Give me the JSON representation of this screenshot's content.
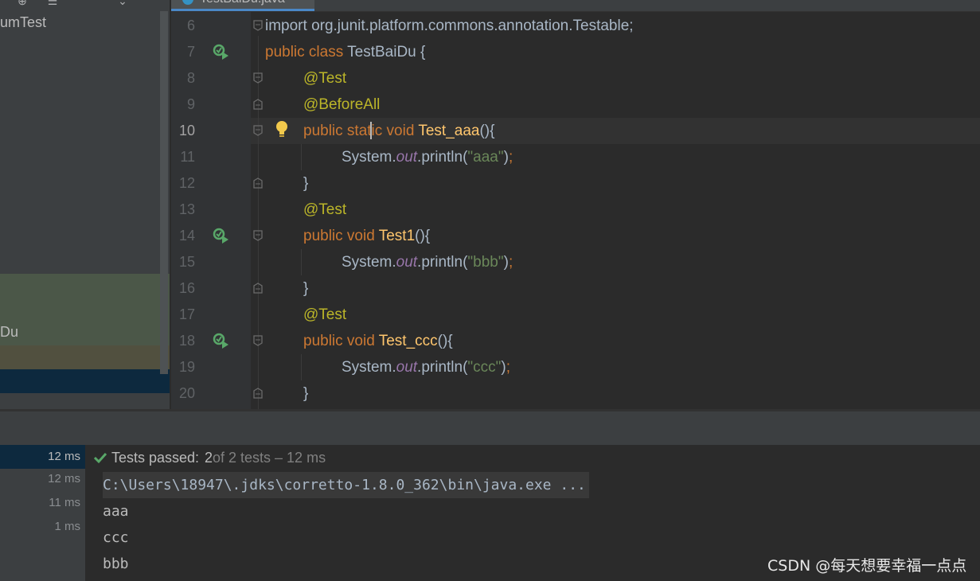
{
  "project": {
    "tree_item_1": "umTest",
    "tree_item_2": "Du"
  },
  "editor": {
    "tab_label": "TestBaiDu.java",
    "lines": [
      {
        "no": "6",
        "code": "import org.junit.platform.commons.annotation.Testable;"
      },
      {
        "no": "7",
        "code": "public class TestBaiDu {"
      },
      {
        "no": "8",
        "code": "@Test"
      },
      {
        "no": "9",
        "code": "@BeforeAll"
      },
      {
        "no": "10",
        "code": "public static void Test_aaa(){"
      },
      {
        "no": "11",
        "code": "System.out.println(\"aaa\");"
      },
      {
        "no": "12",
        "code": "}"
      },
      {
        "no": "13",
        "code": "@Test"
      },
      {
        "no": "14",
        "code": "public void Test1(){"
      },
      {
        "no": "15",
        "code": "System.out.println(\"bbb\");"
      },
      {
        "no": "16",
        "code": "}"
      },
      {
        "no": "17",
        "code": "@Test"
      },
      {
        "no": "18",
        "code": "public void Test_ccc(){"
      },
      {
        "no": "19",
        "code": "System.out.println(\"ccc\");"
      },
      {
        "no": "20",
        "code": "}"
      }
    ],
    "current_line": "10"
  },
  "run": {
    "times": [
      "12 ms",
      "12 ms",
      "11 ms",
      "1 ms"
    ],
    "status_passed": "Tests passed:",
    "status_count": "2",
    "status_rest": "of 2 tests – 12 ms",
    "console": [
      "C:\\Users\\18947\\.jdks\\corretto-1.8.0_362\\bin\\java.exe ...",
      "aaa",
      "ccc",
      "bbb"
    ]
  },
  "watermark": "CSDN @每天想要幸福一点点",
  "colors": {
    "keyword": "#cc7832",
    "annotation": "#bbb529",
    "function": "#ffc66d",
    "string": "#6a8759",
    "field": "#9876aa",
    "pass_green": "#59a869"
  }
}
